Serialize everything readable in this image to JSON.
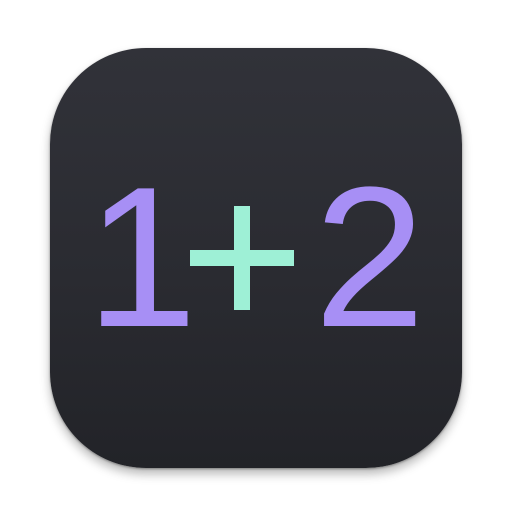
{
  "icon": {
    "expression": {
      "left_operand": "1",
      "operator": "+",
      "right_operand": "2"
    },
    "colors": {
      "operand": "#a78ff5",
      "operator": "#9ef0d6",
      "background": "#2b2c32"
    }
  }
}
